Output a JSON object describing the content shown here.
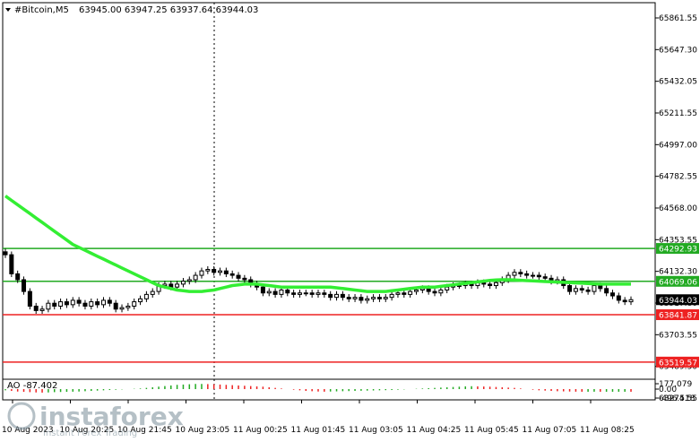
{
  "header": {
    "symbol": "#Bitcoin,M5",
    "ohlc": "63945.00 63947.25 63937.64 63944.03"
  },
  "indicator": {
    "label": "AO -87.402"
  },
  "watermark": {
    "brand": "instaforex",
    "tagline": "Instant Forex Trading"
  },
  "colors": {
    "background": "#ffffff",
    "candle": "#000000",
    "ma_line": "#33ee33",
    "support_line": "#ee2222",
    "resistance_line": "#22aa22",
    "ao_up": "#22aa22",
    "ao_down": "#ee2222",
    "price_tag_dark": "#000000"
  },
  "chart_data": {
    "type": "candlestick",
    "price_axis": {
      "ticks": [
        "65861.55",
        "65647.30",
        "65432.05",
        "65211.55",
        "64997.00",
        "64782.55",
        "64568.00",
        "64353.55",
        "64132.30",
        "63917.80",
        "63703.55",
        "63489.30",
        "63274.55"
      ],
      "range": [
        63274.55,
        65861.55
      ]
    },
    "time_axis": {
      "ticks": [
        "10 Aug 2023",
        "10 Aug 20:25",
        "10 Aug 21:45",
        "10 Aug 23:05",
        "11 Aug 00:25",
        "11 Aug 01:45",
        "11 Aug 03:05",
        "11 Aug 04:25",
        "11 Aug 05:45",
        "11 Aug 07:05",
        "11 Aug 08:25"
      ]
    },
    "levels": [
      {
        "price": 64292.93,
        "label": "64292.93",
        "role": "resistance"
      },
      {
        "price": 64069.06,
        "label": "64069.06",
        "role": "resistance"
      },
      {
        "price": 63841.87,
        "label": "63841.87",
        "role": "support"
      },
      {
        "price": 63519.57,
        "label": "63519.57",
        "role": "support"
      }
    ],
    "current_price": {
      "price": 63944.03,
      "label": "63944.03"
    },
    "close_series": [
      64250,
      64120,
      64080,
      64000,
      63900,
      63870,
      63880,
      63920,
      63900,
      63930,
      63910,
      63940,
      63920,
      63900,
      63930,
      63910,
      63940,
      63920,
      63880,
      63890,
      63900,
      63930,
      63950,
      63980,
      64000,
      64040,
      64050,
      64030,
      64050,
      64070,
      64080,
      64110,
      64140,
      64150,
      64130,
      64140,
      64120,
      64110,
      64090,
      64080,
      64050,
      64030,
      63990,
      64000,
      63980,
      64010,
      63990,
      63980,
      63990,
      63990,
      63980,
      63990,
      63980,
      63960,
      63980,
      63960,
      63950,
      63960,
      63940,
      63950,
      63960,
      63950,
      63960,
      63980,
      63990,
      63980,
      64000,
      64010,
      64020,
      64000,
      63990,
      64010,
      64030,
      64040,
      64040,
      64050,
      64040,
      64060,
      64050,
      64040,
      64060,
      64080,
      64110,
      64130,
      64120,
      64110,
      64110,
      64100,
      64090,
      64070,
      64080,
      64040,
      64000,
      64020,
      64010,
      64000,
      64040,
      64020,
      63990,
      63970,
      63940,
      63930,
      63944.03
    ],
    "ma_series": [
      64650,
      64620,
      64590,
      64560,
      64530,
      64500,
      64470,
      64440,
      64410,
      64380,
      64350,
      64320,
      64300,
      64280,
      64260,
      64240,
      64220,
      64200,
      64180,
      64160,
      64140,
      64120,
      64100,
      64080,
      64060,
      64040,
      64030,
      64020,
      64010,
      64005,
      64000,
      64000,
      64000,
      64005,
      64010,
      64020,
      64030,
      64040,
      64045,
      64050,
      64050,
      64050,
      64045,
      64040,
      64035,
      64030,
      64030,
      64030,
      64030,
      64030,
      64030,
      64030,
      64030,
      64030,
      64025,
      64020,
      64015,
      64010,
      64005,
      64000,
      64000,
      64000,
      64000,
      64005,
      64010,
      64015,
      64020,
      64025,
      64030,
      64030,
      64030,
      64035,
      64040,
      64045,
      64050,
      64055,
      64060,
      64065,
      64070,
      64075,
      64078,
      64080,
      64080,
      64078,
      64076,
      64074,
      64072,
      64070,
      64068,
      64066,
      64064,
      64062,
      64060,
      64058,
      64056,
      64054,
      64052,
      64050,
      64050,
      64050,
      64050,
      64050,
      64050
    ],
    "ao_axis": {
      "ticks": [
        "177.079",
        "0.00",
        "-496.518"
      ],
      "range": [
        -496.518,
        177.079
      ]
    },
    "ao_series": [
      -40,
      -60,
      -80,
      -90,
      -100,
      -110,
      -115,
      -110,
      -100,
      -95,
      -90,
      -85,
      -80,
      -70,
      -60,
      -50,
      -40,
      -30,
      -20,
      -10,
      0,
      10,
      20,
      40,
      60,
      80,
      100,
      120,
      140,
      150,
      160,
      170,
      170,
      165,
      160,
      150,
      140,
      130,
      120,
      110,
      100,
      90,
      80,
      60,
      40,
      20,
      0,
      -20,
      -40,
      -60,
      -70,
      -80,
      -85,
      -80,
      -75,
      -70,
      -65,
      -60,
      -55,
      -50,
      -45,
      -40,
      -35,
      -30,
      -20,
      -10,
      0,
      10,
      20,
      30,
      40,
      50,
      60,
      70,
      80,
      90,
      95,
      90,
      85,
      80,
      70,
      60,
      50,
      40,
      20,
      0,
      -20,
      -40,
      -50,
      -60,
      -70,
      -75,
      -80,
      -85,
      -87,
      -87,
      -86,
      -87,
      -87,
      -87,
      -87,
      -87,
      -87.402
    ]
  }
}
